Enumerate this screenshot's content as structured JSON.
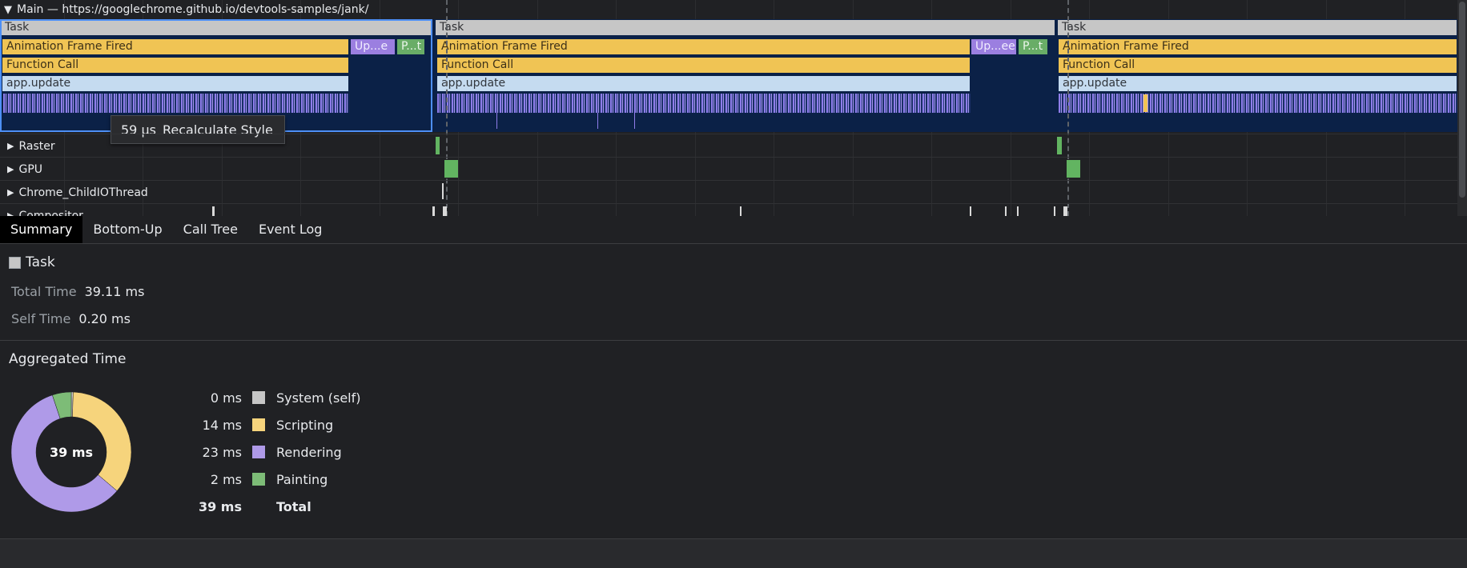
{
  "main_track": {
    "label": "Main — https://googlechrome.github.io/devtools-samples/jank/",
    "events": {
      "task": "Task",
      "animation_frame": "Animation Frame Fired",
      "function_call": "Function Call",
      "app_update": "app.update",
      "update_short_1": "Up...e",
      "paint_short_1": "P...t",
      "update_short_2": "Up...ee",
      "paint_short_2": "P...t"
    }
  },
  "tooltip": {
    "duration": "59 µs",
    "name": "Recalculate Style"
  },
  "tracks": [
    {
      "label": "Raster"
    },
    {
      "label": "GPU"
    },
    {
      "label": "Chrome_ChildIOThread"
    },
    {
      "label": "Compositor"
    }
  ],
  "tabs": [
    "Summary",
    "Bottom-Up",
    "Call Tree",
    "Event Log"
  ],
  "summary": {
    "title": "Task",
    "total_time_label": "Total Time",
    "total_time_value": "39.11 ms",
    "self_time_label": "Self Time",
    "self_time_value": "0.20 ms"
  },
  "aggregated": {
    "title": "Aggregated Time",
    "center_label": "39 ms",
    "rows": [
      {
        "value": "0 ms",
        "label": "System (self)",
        "color": "#c6c6c6",
        "ms": 0.2
      },
      {
        "value": "14 ms",
        "label": "Scripting",
        "color": "#f6d47c",
        "ms": 14
      },
      {
        "value": "23 ms",
        "label": "Rendering",
        "color": "#af9ae8",
        "ms": 23
      },
      {
        "value": "2 ms",
        "label": "Painting",
        "color": "#7dbc77",
        "ms": 2
      }
    ],
    "total_value": "39 ms",
    "total_label": "Total"
  }
}
